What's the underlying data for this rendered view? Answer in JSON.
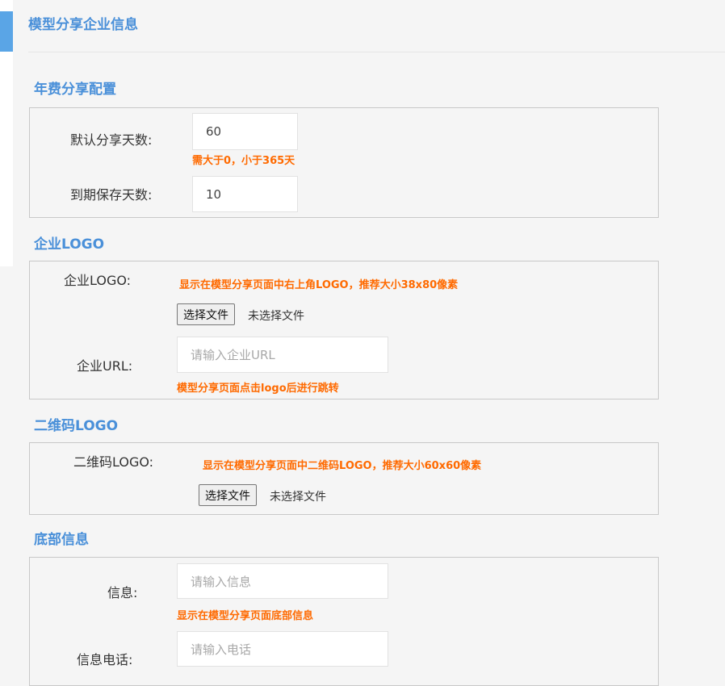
{
  "page": {
    "title": "模型分享企业信息"
  },
  "annual_share": {
    "title": "年费分享配置",
    "default_days_label": "默认分享天数:",
    "default_days_value": "60",
    "default_days_hint": "需大于0，小于365天",
    "expire_keep_label": "到期保存天数:",
    "expire_keep_value": "10"
  },
  "company_logo": {
    "title": "企业LOGO",
    "logo_label": "企业LOGO:",
    "logo_hint": "显示在模型分享页面中右上角LOGO，推荐大小38x80像素",
    "choose_file_label": "选择文件",
    "no_file_text": "未选择文件",
    "url_label": "企业URL:",
    "url_placeholder": "请输入企业URL",
    "url_hint": "模型分享页面点击logo后进行跳转"
  },
  "qr_logo": {
    "title": "二维码LOGO",
    "logo_label": "二维码LOGO:",
    "logo_hint": "显示在模型分享页面中二维码LOGO，推荐大小60x60像素",
    "choose_file_label": "选择文件",
    "no_file_text": "未选择文件"
  },
  "footer_info": {
    "title": "底部信息",
    "info_label": "信息:",
    "info_placeholder": "请输入信息",
    "info_hint": "显示在模型分享页面底部信息",
    "phone_label": "信息电话:",
    "phone_placeholder": "请输入电话"
  },
  "colors": {
    "accent": "#4a90d9",
    "hint": "#ff6a00",
    "accent_bar": "#5aa5e6"
  }
}
